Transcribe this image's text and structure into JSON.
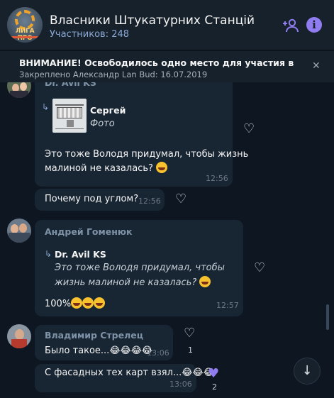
{
  "header": {
    "logo_text": "ЛИГА ПРО",
    "title": "Власники Штукатурних Станцій",
    "members": "Участников: 248",
    "add_icon": "add-user-icon",
    "info_icon": "info-icon",
    "info_glyph": "i"
  },
  "pinned": {
    "title": "ВНИМАНИЕ! Освободилось одно место для участия в Турн...",
    "subtitle": "Закреплено Александр Lan Bud: 16.07.2019",
    "close_glyph": "✕"
  },
  "messages": [
    {
      "sender": "Dr. Avil KS",
      "reply_name": "Сергей",
      "reply_text": "Фото",
      "text_lines": [
        "Это тоже Володя придумал, чтобы жизнь",
        "малиной не казалась?"
      ],
      "time": "12:56"
    },
    {
      "text": "Почему под углом?",
      "time": "12:56"
    },
    {
      "sender": "Андрей Гоменюк",
      "reply_name": "Dr. Avil KS",
      "reply_lines": [
        "Это тоже Володя придумал, чтобы",
        "жизнь малиной не казалась?"
      ],
      "text": "100%",
      "time": "12:57"
    },
    {
      "sender": "Владимир Стрелец",
      "text": "Было такое...😂😂😂😂",
      "time": "13:06",
      "reaction_count": "1"
    },
    {
      "text": "С фасадных тех карт взял...😂😂😂",
      "time": "13:06",
      "reaction_count": "2"
    }
  ],
  "icons": {
    "heart": "♡",
    "heart_filled": "♥",
    "reply_arrow": "↳",
    "scroll_down": "↓"
  },
  "colors": {
    "background": "#0e1621",
    "header": "#17212b",
    "bubble": "#182533",
    "accent": "#8e7cf0",
    "link": "#8aa9d6"
  }
}
